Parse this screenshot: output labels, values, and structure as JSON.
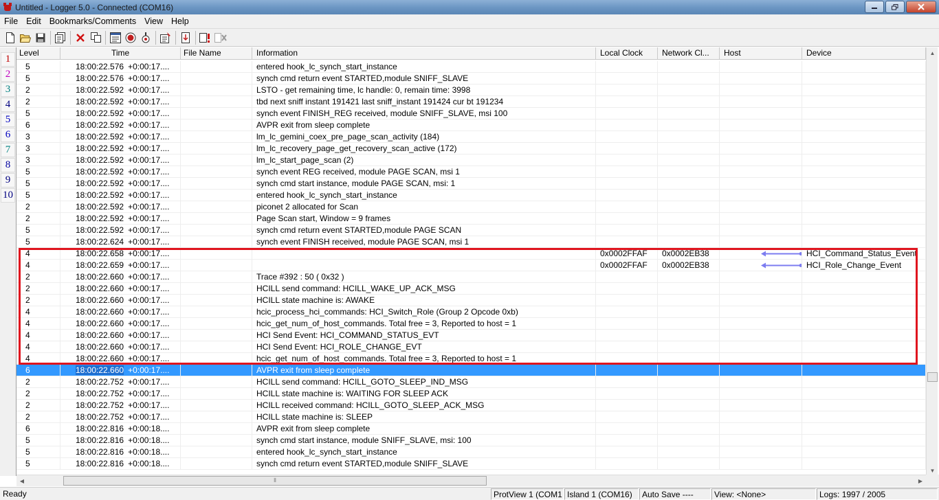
{
  "window": {
    "title": "Untitled - Logger 5.0 - Connected  (COM16)",
    "controls": [
      "minimize",
      "maximize",
      "close"
    ]
  },
  "menu": [
    "File",
    "Edit",
    "Bookmarks/Comments",
    "View",
    "Help"
  ],
  "toolbar": {
    "buttons": [
      "new-file",
      "open-folder",
      "save",
      "bookmarks",
      "delete",
      "copy",
      "filter",
      "record",
      "trace",
      "properties",
      "export",
      "error-filter",
      "clear-filter"
    ]
  },
  "bookmarks": [
    {
      "label": "1",
      "color": "#c00000"
    },
    {
      "label": "2",
      "color": "#c000c0"
    },
    {
      "label": "3",
      "color": "#008080"
    },
    {
      "label": "4",
      "color": "#000080"
    },
    {
      "label": "5",
      "color": "#0000c0"
    },
    {
      "label": "6",
      "color": "#0000c0"
    },
    {
      "label": "7",
      "color": "#008080"
    },
    {
      "label": "8",
      "color": "#0000a0"
    },
    {
      "label": "9",
      "color": "#000080"
    },
    {
      "label": "10",
      "color": "#000080"
    }
  ],
  "columns": [
    "Level",
    "Time",
    "File Name",
    "Information",
    "Local Clock",
    "Network Cl...",
    "Host",
    "Device"
  ],
  "rows": [
    {
      "level": "5",
      "time": "18:00:22.576",
      "delta": "+0:00:17....",
      "file": "",
      "info": "entered hook_lc_synch_start_instance",
      "local_clock": "",
      "network_clock": "",
      "host": "",
      "device": ""
    },
    {
      "level": "5",
      "time": "18:00:22.576",
      "delta": "+0:00:17....",
      "file": "",
      "info": "synch cmd return event STARTED,module SNIFF_SLAVE",
      "local_clock": "",
      "network_clock": "",
      "host": "",
      "device": ""
    },
    {
      "level": "2",
      "time": "18:00:22.592",
      "delta": "+0:00:17....",
      "file": "",
      "info": "LSTO - get remaining time, lc handle: 0, remain time: 3998",
      "local_clock": "",
      "network_clock": "",
      "host": "",
      "device": ""
    },
    {
      "level": "2",
      "time": "18:00:22.592",
      "delta": "+0:00:17....",
      "file": "",
      "info": "tbd next sniff instant 191421 last sniff_instant 191424 cur bt 191234",
      "local_clock": "",
      "network_clock": "",
      "host": "",
      "device": ""
    },
    {
      "level": "5",
      "time": "18:00:22.592",
      "delta": "+0:00:17....",
      "file": "",
      "info": "synch event FINISH_REG received, module SNIFF_SLAVE, msi 100",
      "local_clock": "",
      "network_clock": "",
      "host": "",
      "device": ""
    },
    {
      "level": "6",
      "time": "18:00:22.592",
      "delta": "+0:00:17....",
      "file": "",
      "info": "AVPR exit from sleep complete",
      "local_clock": "",
      "network_clock": "",
      "host": "",
      "device": ""
    },
    {
      "level": "3",
      "time": "18:00:22.592",
      "delta": "+0:00:17....",
      "file": "",
      "info": "lm_lc_gemini_coex_pre_page_scan_activity (184)",
      "local_clock": "",
      "network_clock": "",
      "host": "",
      "device": ""
    },
    {
      "level": "3",
      "time": "18:00:22.592",
      "delta": "+0:00:17....",
      "file": "",
      "info": "lm_lc_recovery_page_get_recovery_scan_active (172)",
      "local_clock": "",
      "network_clock": "",
      "host": "",
      "device": ""
    },
    {
      "level": "3",
      "time": "18:00:22.592",
      "delta": "+0:00:17....",
      "file": "",
      "info": "lm_lc_start_page_scan (2)",
      "local_clock": "",
      "network_clock": "",
      "host": "",
      "device": ""
    },
    {
      "level": "5",
      "time": "18:00:22.592",
      "delta": "+0:00:17....",
      "file": "",
      "info": "synch event REG received, module PAGE SCAN, msi 1",
      "local_clock": "",
      "network_clock": "",
      "host": "",
      "device": ""
    },
    {
      "level": "5",
      "time": "18:00:22.592",
      "delta": "+0:00:17....",
      "file": "",
      "info": "synch cmd start instance, module PAGE SCAN, msi: 1",
      "local_clock": "",
      "network_clock": "",
      "host": "",
      "device": ""
    },
    {
      "level": "5",
      "time": "18:00:22.592",
      "delta": "+0:00:17....",
      "file": "",
      "info": "entered hook_lc_synch_start_instance",
      "local_clock": "",
      "network_clock": "",
      "host": "",
      "device": ""
    },
    {
      "level": "2",
      "time": "18:00:22.592",
      "delta": "+0:00:17....",
      "file": "",
      "info": "piconet 2 allocated for Scan",
      "local_clock": "",
      "network_clock": "",
      "host": "",
      "device": ""
    },
    {
      "level": "2",
      "time": "18:00:22.592",
      "delta": "+0:00:17....",
      "file": "",
      "info": "Page Scan start, Window = 9 frames",
      "local_clock": "",
      "network_clock": "",
      "host": "",
      "device": ""
    },
    {
      "level": "5",
      "time": "18:00:22.592",
      "delta": "+0:00:17....",
      "file": "",
      "info": "synch cmd return event STARTED,module PAGE SCAN",
      "local_clock": "",
      "network_clock": "",
      "host": "",
      "device": ""
    },
    {
      "level": "5",
      "time": "18:00:22.624",
      "delta": "+0:00:17....",
      "file": "",
      "info": "synch event FINISH received, module PAGE SCAN, msi 1",
      "local_clock": "",
      "network_clock": "",
      "host": "",
      "device": ""
    },
    {
      "level": "4",
      "time": "18:00:22.658",
      "delta": "+0:00:17....",
      "file": "",
      "info": "",
      "local_clock": "0x0002FFAF",
      "network_clock": "0x0002EB38",
      "host": "",
      "device": "HCI_Command_Status_Event",
      "arrow": true
    },
    {
      "level": "4",
      "time": "18:00:22.659",
      "delta": "+0:00:17....",
      "file": "",
      "info": "",
      "local_clock": "0x0002FFAF",
      "network_clock": "0x0002EB38",
      "host": "",
      "device": "HCI_Role_Change_Event",
      "arrow": true
    },
    {
      "level": "2",
      "time": "18:00:22.660",
      "delta": "+0:00:17....",
      "file": "",
      "info": "Trace #392  : 50 ( 0x32 )",
      "local_clock": "",
      "network_clock": "",
      "host": "",
      "device": ""
    },
    {
      "level": "2",
      "time": "18:00:22.660",
      "delta": "+0:00:17....",
      "file": "",
      "info": "HCILL send command: HCILL_WAKE_UP_ACK_MSG",
      "local_clock": "",
      "network_clock": "",
      "host": "",
      "device": ""
    },
    {
      "level": "2",
      "time": "18:00:22.660",
      "delta": "+0:00:17....",
      "file": "",
      "info": "HCILL state machine is: AWAKE",
      "local_clock": "",
      "network_clock": "",
      "host": "",
      "device": ""
    },
    {
      "level": "4",
      "time": "18:00:22.660",
      "delta": "+0:00:17....",
      "file": "",
      "info": "hcic_process_hci_commands: HCI_Switch_Role (Group 2 Opcode 0xb)",
      "local_clock": "",
      "network_clock": "",
      "host": "",
      "device": ""
    },
    {
      "level": "4",
      "time": "18:00:22.660",
      "delta": "+0:00:17....",
      "file": "",
      "info": "hcic_get_num_of_host_commands. Total free = 3, Reported to host = 1",
      "local_clock": "",
      "network_clock": "",
      "host": "",
      "device": ""
    },
    {
      "level": "4",
      "time": "18:00:22.660",
      "delta": "+0:00:17....",
      "file": "",
      "info": "HCI Send Event: HCI_COMMAND_STATUS_EVT",
      "local_clock": "",
      "network_clock": "",
      "host": "",
      "device": ""
    },
    {
      "level": "4",
      "time": "18:00:22.660",
      "delta": "+0:00:17....",
      "file": "",
      "info": "HCI Send Event: HCI_ROLE_CHANGE_EVT",
      "local_clock": "",
      "network_clock": "",
      "host": "",
      "device": ""
    },
    {
      "level": "4",
      "time": "18:00:22.660",
      "delta": "+0:00:17....",
      "file": "",
      "info": "hcic_get_num_of_host_commands. Total free = 3, Reported to host = 1",
      "local_clock": "",
      "network_clock": "",
      "host": "",
      "device": ""
    },
    {
      "level": "6",
      "time": "18:00:22.660",
      "delta": "+0:00:17....",
      "file": "",
      "info": "AVPR exit from sleep complete",
      "local_clock": "",
      "network_clock": "",
      "host": "",
      "device": "",
      "selected": true
    },
    {
      "level": "2",
      "time": "18:00:22.752",
      "delta": "+0:00:17....",
      "file": "",
      "info": "HCILL send command: HCILL_GOTO_SLEEP_IND_MSG",
      "local_clock": "",
      "network_clock": "",
      "host": "",
      "device": ""
    },
    {
      "level": "2",
      "time": "18:00:22.752",
      "delta": "+0:00:17....",
      "file": "",
      "info": "HCILL state machine is: WAITING FOR SLEEP ACK",
      "local_clock": "",
      "network_clock": "",
      "host": "",
      "device": ""
    },
    {
      "level": "2",
      "time": "18:00:22.752",
      "delta": "+0:00:17....",
      "file": "",
      "info": "HCILL received command: HCILL_GOTO_SLEEP_ACK_MSG",
      "local_clock": "",
      "network_clock": "",
      "host": "",
      "device": ""
    },
    {
      "level": "2",
      "time": "18:00:22.752",
      "delta": "+0:00:17....",
      "file": "",
      "info": "HCILL state machine is: SLEEP",
      "local_clock": "",
      "network_clock": "",
      "host": "",
      "device": ""
    },
    {
      "level": "6",
      "time": "18:00:22.816",
      "delta": "+0:00:18....",
      "file": "",
      "info": "AVPR exit from sleep complete",
      "local_clock": "",
      "network_clock": "",
      "host": "",
      "device": ""
    },
    {
      "level": "5",
      "time": "18:00:22.816",
      "delta": "+0:00:18....",
      "file": "",
      "info": "synch cmd start instance, module SNIFF_SLAVE, msi: 100",
      "local_clock": "",
      "network_clock": "",
      "host": "",
      "device": ""
    },
    {
      "level": "5",
      "time": "18:00:22.816",
      "delta": "+0:00:18....",
      "file": "",
      "info": "entered hook_lc_synch_start_instance",
      "local_clock": "",
      "network_clock": "",
      "host": "",
      "device": ""
    },
    {
      "level": "5",
      "time": "18:00:22.816",
      "delta": "+0:00:18....",
      "file": "",
      "info": "synch cmd return event STARTED,module SNIFF_SLAVE",
      "local_clock": "",
      "network_clock": "",
      "host": "",
      "device": ""
    }
  ],
  "statusbar": {
    "ready": "Ready",
    "protview": "ProtView 1 (COM1",
    "island": "Island 1 (COM16)",
    "autosave": "Auto Save ----",
    "view": "View: <None>",
    "logs": "Logs: 1997 / 2005"
  },
  "colors": {
    "selection": "#3399ff",
    "highlight_box": "#e0141e",
    "arrow": "#7c7cf0"
  }
}
